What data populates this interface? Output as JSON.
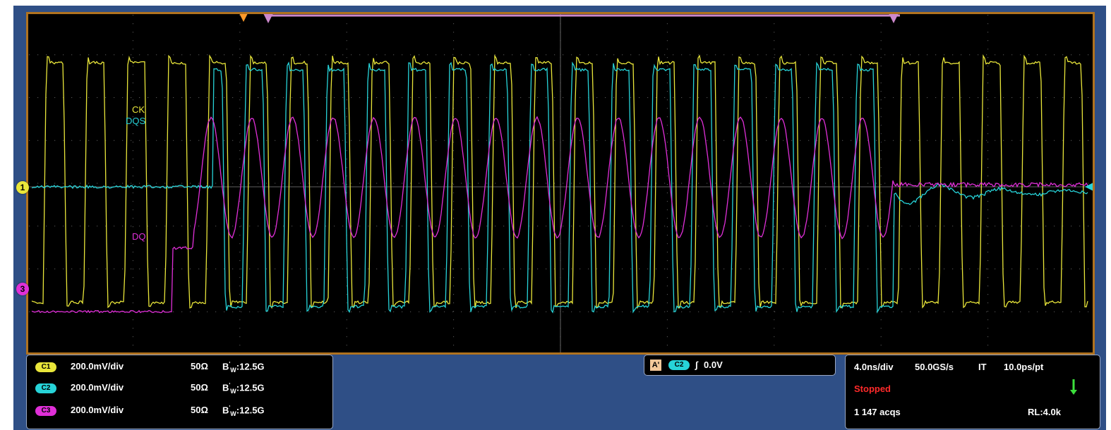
{
  "channels": [
    {
      "id": "C1",
      "label": "C1",
      "scale": "200.0mV/div",
      "impedance": "50Ω",
      "bw_prefix": "B",
      "bw_sup": "'",
      "bw_sub": "W",
      "bw_value": ":12.5G",
      "color": "#e9e63a"
    },
    {
      "id": "C2",
      "label": "C2",
      "scale": "200.0mV/div",
      "impedance": "50Ω",
      "bw_prefix": "B",
      "bw_sup": "'",
      "bw_sub": "W",
      "bw_value": ":12.5G",
      "color": "#27d3d8"
    },
    {
      "id": "C3",
      "label": "C3",
      "scale": "200.0mV/div",
      "impedance": "50Ω",
      "bw_prefix": "B",
      "bw_sup": "'",
      "bw_sub": "W",
      "bw_value": ":12.5G",
      "color": "#e02fd8"
    }
  ],
  "trace_labels": {
    "ck": "CK",
    "dqs": "DQS",
    "dq": "DQ"
  },
  "markers": {
    "ch1": "1",
    "ch3": "3"
  },
  "trigger": {
    "mode": "A'",
    "source": "C2",
    "slope_symbol": "∫",
    "level": "0.0V"
  },
  "acquisition": {
    "time_div": "4.0ns/div",
    "sample_rate": "50.0GS/s",
    "mode": "IT",
    "resolution": "10.0ps/pt",
    "state": "Stopped",
    "acqs": "1 147 acqs",
    "record_length": "RL:4.0k"
  },
  "colors": {
    "ck": "#e9e63a",
    "dqs": "#27d3d8",
    "dq": "#e02fd8",
    "frame": "#b0721f",
    "bezel": "#2f4f86",
    "stopped": "#ff2a2a"
  }
}
